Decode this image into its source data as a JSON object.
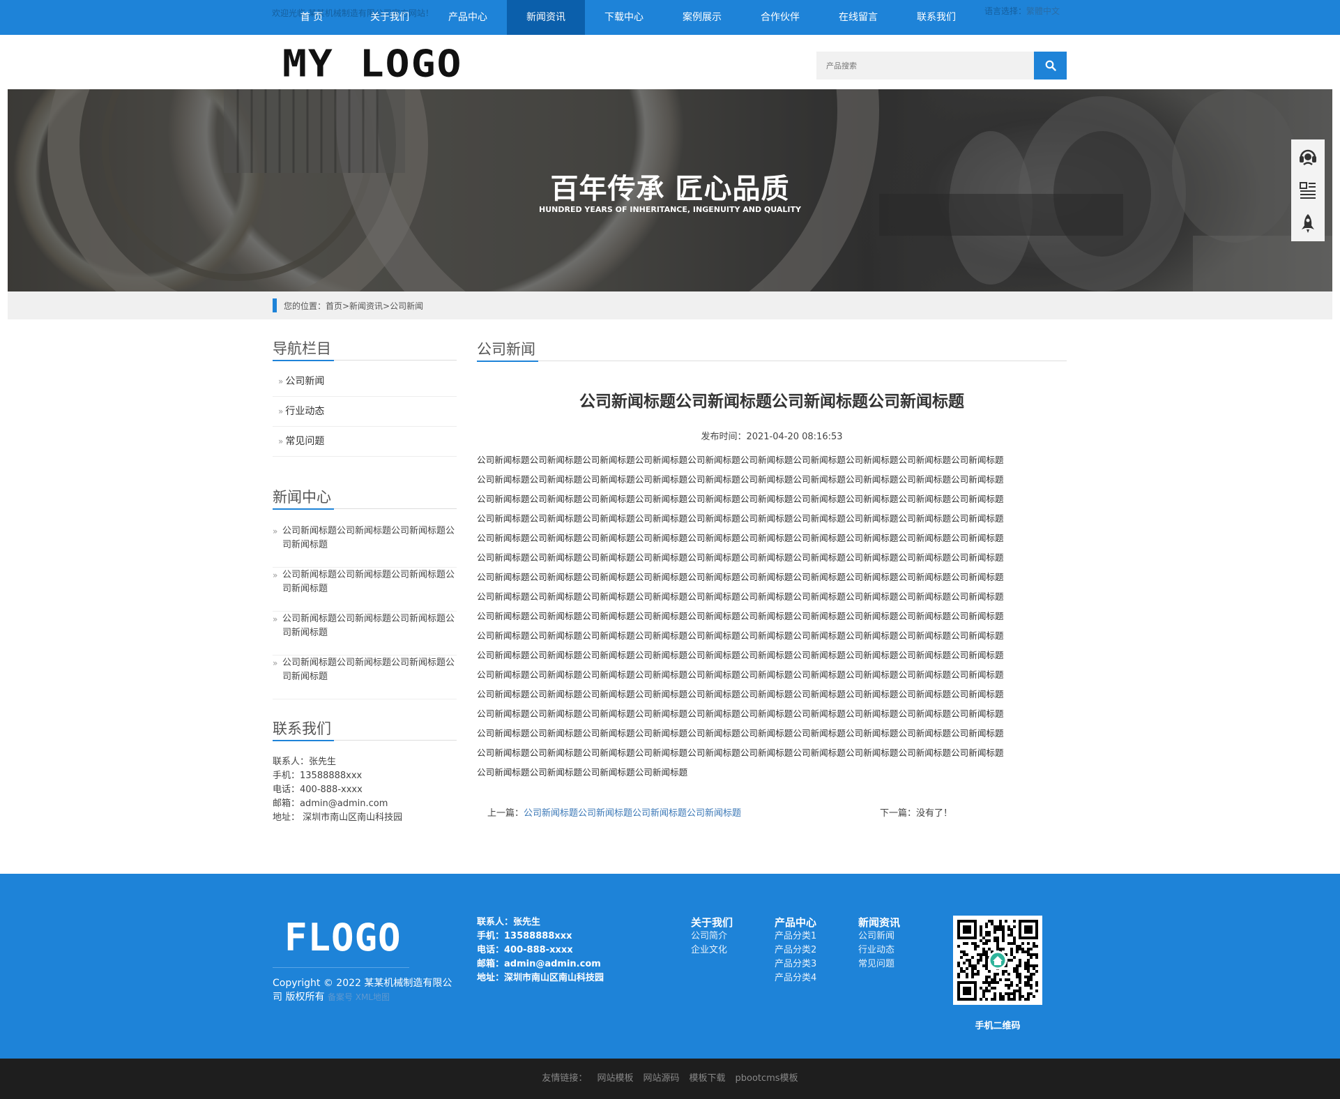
{
  "topbar": {
    "welcome": "欢迎光临 某某机械制造有限公司官方网站！",
    "lang_label": "语言选择：",
    "lang_value": "繁體中文",
    "nav": [
      "首 页",
      "关于我们",
      "产品中心",
      "新闻资讯",
      "下载中心",
      "案例展示",
      "合作伙伴",
      "在线留言",
      "联系我们"
    ],
    "active_nav": "新闻资讯"
  },
  "header": {
    "logo": "MY LOGO",
    "search_placeholder": "产品搜索"
  },
  "banner": {
    "title": "百年传承 匠心品质",
    "subtitle": "HUNDRED YEARS OF INHERITANCE, INGENUITY AND QUALITY"
  },
  "floatbar": {
    "icons": [
      "headset-icon",
      "qrcode-icon",
      "rocket-icon"
    ]
  },
  "breadcrumb": {
    "text": "您的位置：首页>新闻资讯>公司新闻"
  },
  "sidebar": {
    "nav_title": "导航栏目",
    "nav_items": [
      "公司新闻",
      "行业动态",
      "常见问题"
    ],
    "news_title": "新闻中心",
    "news_items": [
      "公司新闻标题公司新闻标题公司新闻标题公司新闻标题",
      "公司新闻标题公司新闻标题公司新闻标题公司新闻标题",
      "公司新闻标题公司新闻标题公司新闻标题公司新闻标题",
      "公司新闻标题公司新闻标题公司新闻标题公司新闻标题"
    ],
    "contact_title": "联系我们",
    "contact": {
      "person": "联系人：张先生",
      "mobile": "手机：13588888xxx",
      "phone": "电话：400-888-xxxx",
      "email": "邮箱：admin@admin.com",
      "address": "地址：  深圳市南山区南山科技园"
    }
  },
  "main": {
    "section_title": "公司新闻",
    "article_title": "公司新闻标题公司新闻标题公司新闻标题公司新闻标题",
    "publish_time": "发布时间：2021-04-20 08:16:53",
    "body_line": "公司新闻标题公司新闻标题公司新闻标题公司新闻标题公司新闻标题公司新闻标题公司新闻标题公司新闻标题公司新闻标题公司新闻标题",
    "body_last_line": "公司新闻标题公司新闻标题公司新闻标题公司新闻标题",
    "body_full_lines": 16,
    "prev_label": "上一篇：",
    "prev_link": "公司新闻标题公司新闻标题公司新闻标题公司新闻标题",
    "next_text": "下一篇：没有了！"
  },
  "footer": {
    "logo": "FLOGO",
    "copyright": "Copyright © 2022 某某机械制造有限公司 版权所有",
    "icp": "备案号 XML地图",
    "contact": {
      "person": "联系人：张先生",
      "mobile": "手机：13588888xxx",
      "phone": "电话：400-888-xxxx",
      "email": "邮箱：admin@admin.com",
      "address": "地址：深圳市南山区南山科技园"
    },
    "columns": [
      {
        "title": "关于我们",
        "links": [
          "公司简介",
          "企业文化"
        ]
      },
      {
        "title": "产品中心",
        "links": [
          "产品分类1",
          "产品分类2",
          "产品分类3",
          "产品分类4"
        ]
      },
      {
        "title": "新闻资讯",
        "links": [
          "公司新闻",
          "行业动态",
          "常见问题"
        ]
      }
    ],
    "qr_caption": "手机二维码"
  },
  "bottom": {
    "label": "友情链接：",
    "links": [
      "网站模板",
      "网站源码",
      "模板下载",
      "pbootcms模板"
    ]
  },
  "colors": {
    "brand_blue": "#1e83d8",
    "nav_active": "#0b5fab",
    "bottom_bar": "#1e1e1e"
  }
}
